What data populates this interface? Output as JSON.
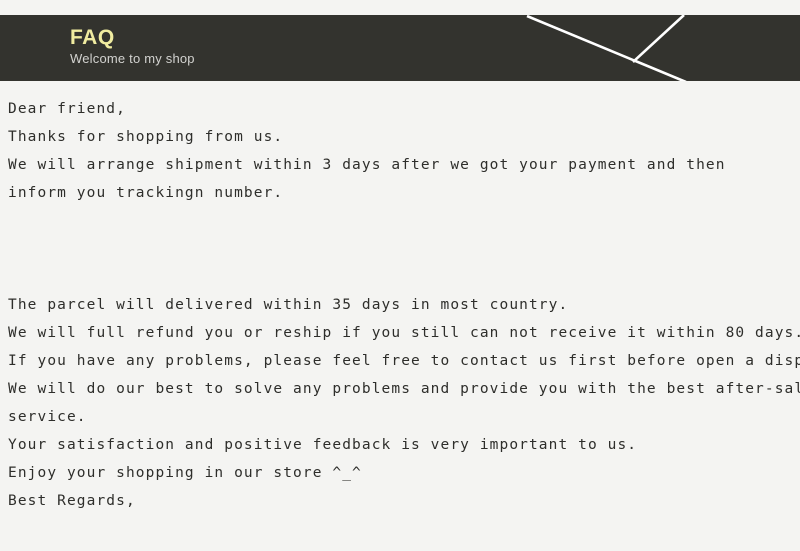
{
  "colors": {
    "page_background": "#f4f4f2",
    "banner_background": "#33332e",
    "banner_title": "#f0eca0",
    "banner_subtitle": "#d2d2cf",
    "body_text": "#2e2e2b",
    "deco_line": "#ffffff"
  },
  "header": {
    "title": "FAQ",
    "subtitle": "Welcome to my shop"
  },
  "body": {
    "paragraphs": [
      {
        "id": "greeting-paragraph",
        "lines": [
          "Dear friend,",
          "Thanks for shopping from us.",
          "We will arrange shipment within 3 days after we got your payment and then",
          "inform you trackingn number."
        ]
      },
      {
        "id": "policy-paragraph",
        "lines": [
          "The parcel will delivered within 35 days in most country.",
          "We will full refund you or reship if you still can not receive it within 80 days.",
          "If you have any problems, please feel free to contact us first before open a dispute.",
          "We will do our best to solve any problems and provide you with the best after-sale",
          "service.",
          "Your satisfaction and positive feedback is very important to us.",
          "Enjoy your shopping in our store ^_^",
          "Best Regards,"
        ]
      }
    ]
  }
}
